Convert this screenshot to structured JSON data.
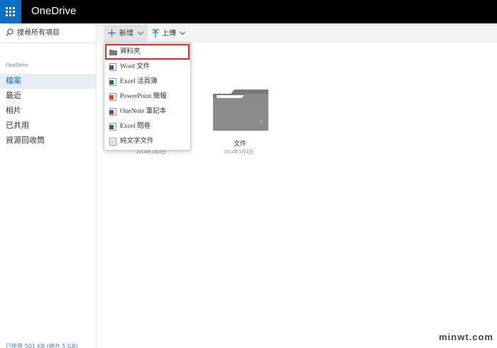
{
  "header": {
    "app_title": "OneDrive"
  },
  "sidebar": {
    "search_placeholder": "搜尋所有項目",
    "section_label": "OneDrive",
    "items": [
      {
        "label": "檔案",
        "active": true
      },
      {
        "label": "最近"
      },
      {
        "label": "相片"
      },
      {
        "label": "已共用"
      },
      {
        "label": "資源回收筒"
      }
    ],
    "storage_text": "已使用 501 KB (總共 5 GB)"
  },
  "toolbar": {
    "new_label": "新增",
    "upload_label": "上傳"
  },
  "new_menu": {
    "items": [
      {
        "label": "資料夾",
        "icon": "folder-icon",
        "highlighted": true
      },
      {
        "label": "Word 文件",
        "icon": "word-icon",
        "color": "#2b579a"
      },
      {
        "label": "Excel 活頁簿",
        "icon": "excel-icon",
        "color": "#217346"
      },
      {
        "label": "PowerPoint 簡報",
        "icon": "powerpoint-icon",
        "color": "#d24726"
      },
      {
        "label": "OneNote 筆記本",
        "icon": "onenote-icon",
        "color": "#80397b"
      },
      {
        "label": "Excel 問卷",
        "icon": "excel-survey-icon",
        "color": "#217346"
      },
      {
        "label": "純文字文件",
        "icon": "text-file-icon"
      }
    ]
  },
  "files": [
    {
      "name": "",
      "date": "2014年3月4日"
    },
    {
      "name": "文件",
      "date": "2014年3月4日",
      "count": "1"
    }
  ],
  "watermark": "minwt.com"
}
